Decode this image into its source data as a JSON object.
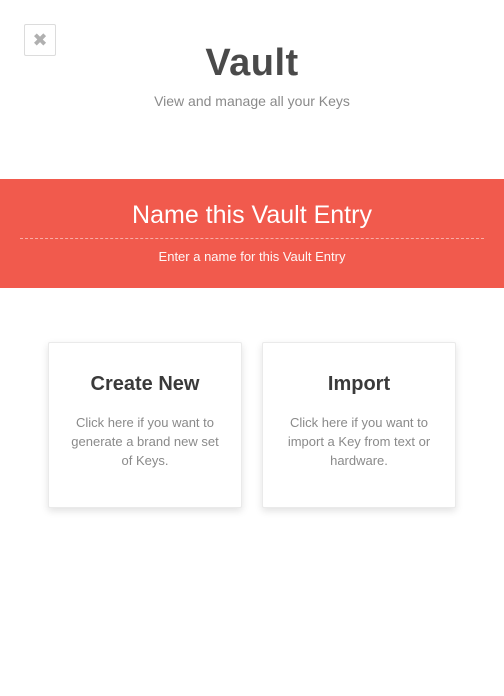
{
  "colors": {
    "accent": "#f15a4d",
    "text_dark": "#4a4a4a",
    "text_muted": "#8a8a8a"
  },
  "header": {
    "close_label": "✖",
    "title": "Vault",
    "subtitle": "View and manage all your Keys"
  },
  "banner": {
    "placeholder": "Name this Vault Entry",
    "hint": "Enter a name for this Vault Entry"
  },
  "cards": {
    "create": {
      "title": "Create New",
      "desc": "Click here if you want to generate a brand new set of Keys."
    },
    "import": {
      "title": "Import",
      "desc": "Click here if you want to import a Key from text or hardware."
    }
  }
}
